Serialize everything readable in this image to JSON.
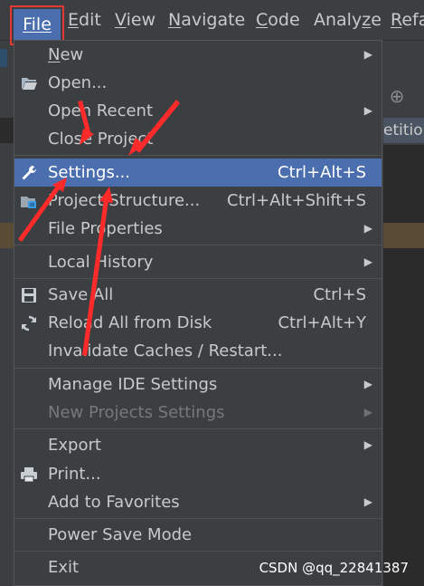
{
  "menubar": {
    "items": [
      {
        "label": "File",
        "mnemonic_index": 0
      },
      {
        "label": "Edit",
        "mnemonic_index": 0
      },
      {
        "label": "View",
        "mnemonic_index": 0
      },
      {
        "label": "Navigate",
        "mnemonic_index": 0
      },
      {
        "label": "Code",
        "mnemonic_index": 0
      },
      {
        "label": "Analyze",
        "mnemonic_index": 5
      },
      {
        "label": "Refa",
        "mnemonic_index": 0
      }
    ]
  },
  "background": {
    "right_tab_text": "etition"
  },
  "file_menu": {
    "items": [
      {
        "label": "New",
        "shortcut": "",
        "submenu": true
      },
      {
        "label": "Open...",
        "shortcut": "",
        "submenu": false,
        "icon": "folder-open-icon"
      },
      {
        "label": "Open Recent",
        "shortcut": "",
        "submenu": true
      },
      {
        "label": "Close Project",
        "shortcut": "",
        "submenu": false
      },
      {
        "label": "Settings...",
        "shortcut": "Ctrl+Alt+S",
        "submenu": false,
        "icon": "wrench-icon",
        "selected": true
      },
      {
        "label": "Project Structure...",
        "shortcut": "Ctrl+Alt+Shift+S",
        "submenu": false,
        "icon": "project-structure-icon"
      },
      {
        "label": "File Properties",
        "shortcut": "",
        "submenu": true
      },
      {
        "label": "Local History",
        "shortcut": "",
        "submenu": true
      },
      {
        "label": "Save All",
        "shortcut": "Ctrl+S",
        "submenu": false,
        "icon": "save-icon"
      },
      {
        "label": "Reload All from Disk",
        "shortcut": "Ctrl+Alt+Y",
        "submenu": false,
        "icon": "reload-icon"
      },
      {
        "label": "Invalidate Caches / Restart...",
        "shortcut": "",
        "submenu": false
      },
      {
        "label": "Manage IDE Settings",
        "shortcut": "",
        "submenu": true
      },
      {
        "label": "New Projects Settings",
        "shortcut": "",
        "submenu": true,
        "disabled": true
      },
      {
        "label": "Export",
        "shortcut": "",
        "submenu": true
      },
      {
        "label": "Print...",
        "shortcut": "",
        "submenu": false,
        "icon": "printer-icon"
      },
      {
        "label": "Add to Favorites",
        "shortcut": "",
        "submenu": true
      },
      {
        "label": "Power Save Mode",
        "shortcut": "",
        "submenu": false
      },
      {
        "label": "Exit",
        "shortcut": "",
        "submenu": false
      }
    ]
  },
  "watermark": "CSDN @qq_22841387",
  "colors": {
    "menu_bg": "#3c3f41",
    "selection": "#4b6eaf",
    "highlight_box": "#e53935",
    "arrow": "#ff2a2a"
  }
}
